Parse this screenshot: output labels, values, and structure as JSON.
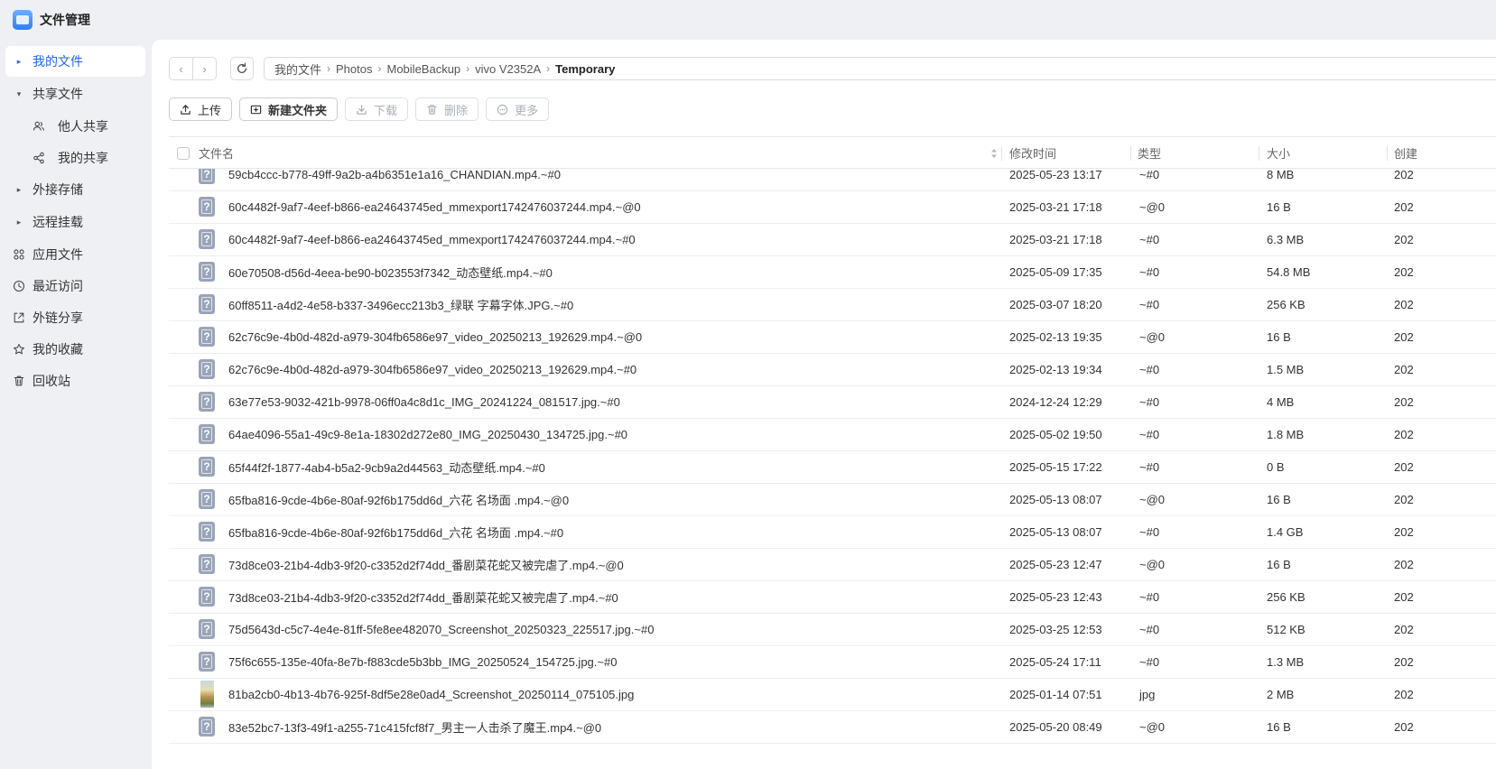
{
  "app": {
    "title": "文件管理"
  },
  "sidebar": {
    "items": [
      {
        "label": "我的文件",
        "caret": "▸",
        "active": true
      },
      {
        "label": "共享文件",
        "caret": "▾"
      },
      {
        "label": "他人共享",
        "icon": "users-icon",
        "sub": true
      },
      {
        "label": "我的共享",
        "icon": "share-icon",
        "sub": true
      },
      {
        "label": "外接存储",
        "caret": "▸"
      },
      {
        "label": "远程挂载",
        "caret": "▸"
      },
      {
        "label": "应用文件",
        "icon": "apps-icon"
      },
      {
        "label": "最近访问",
        "icon": "clock-icon"
      },
      {
        "label": "外链分享",
        "icon": "external-link-icon"
      },
      {
        "label": "我的收藏",
        "icon": "star-icon"
      },
      {
        "label": "回收站",
        "icon": "trash-icon"
      }
    ]
  },
  "nav": {
    "back": "‹",
    "forward": "›"
  },
  "breadcrumb": [
    "我的文件",
    "Photos",
    "MobileBackup",
    "vivo V2352A",
    "Temporary"
  ],
  "toolbar": {
    "upload": "上传",
    "new_folder": "新建文件夹",
    "download": "下载",
    "delete": "删除",
    "more": "更多"
  },
  "table": {
    "columns": {
      "name": "文件名",
      "modified": "修改时间",
      "type": "类型",
      "size": "大小",
      "created": "创建"
    },
    "rows": [
      {
        "name": "59cb4ccc-b778-49ff-9a2b-a4b6351e1a16_CHANDIAN.mp4.~#0",
        "modified": "2025-05-23 13:17",
        "type": "~#0",
        "size": "8 MB",
        "created": "202",
        "icon": "unknown-file-icon"
      },
      {
        "name": "60c4482f-9af7-4eef-b866-ea24643745ed_mmexport1742476037244.mp4.~@0",
        "modified": "2025-03-21 17:18",
        "type": "~@0",
        "size": "16 B",
        "created": "202",
        "icon": "unknown-file-icon"
      },
      {
        "name": "60c4482f-9af7-4eef-b866-ea24643745ed_mmexport1742476037244.mp4.~#0",
        "modified": "2025-03-21 17:18",
        "type": "~#0",
        "size": "6.3 MB",
        "created": "202",
        "icon": "unknown-file-icon"
      },
      {
        "name": "60e70508-d56d-4eea-be90-b023553f7342_动态壁纸.mp4.~#0",
        "modified": "2025-05-09 17:35",
        "type": "~#0",
        "size": "54.8 MB",
        "created": "202",
        "icon": "unknown-file-icon"
      },
      {
        "name": "60ff8511-a4d2-4e58-b337-3496ecc213b3_绿联 字幕字体.JPG.~#0",
        "modified": "2025-03-07 18:20",
        "type": "~#0",
        "size": "256 KB",
        "created": "202",
        "icon": "unknown-file-icon"
      },
      {
        "name": "62c76c9e-4b0d-482d-a979-304fb6586e97_video_20250213_192629.mp4.~@0",
        "modified": "2025-02-13 19:35",
        "type": "~@0",
        "size": "16 B",
        "created": "202",
        "icon": "unknown-file-icon"
      },
      {
        "name": "62c76c9e-4b0d-482d-a979-304fb6586e97_video_20250213_192629.mp4.~#0",
        "modified": "2025-02-13 19:34",
        "type": "~#0",
        "size": "1.5 MB",
        "created": "202",
        "icon": "unknown-file-icon"
      },
      {
        "name": "63e77e53-9032-421b-9978-06ff0a4c8d1c_IMG_20241224_081517.jpg.~#0",
        "modified": "2024-12-24 12:29",
        "type": "~#0",
        "size": "4 MB",
        "created": "202",
        "icon": "unknown-file-icon"
      },
      {
        "name": "64ae4096-55a1-49c9-8e1a-18302d272e80_IMG_20250430_134725.jpg.~#0",
        "modified": "2025-05-02 19:50",
        "type": "~#0",
        "size": "1.8 MB",
        "created": "202",
        "icon": "unknown-file-icon"
      },
      {
        "name": "65f44f2f-1877-4ab4-b5a2-9cb9a2d44563_动态壁纸.mp4.~#0",
        "modified": "2025-05-15 17:22",
        "type": "~#0",
        "size": "0 B",
        "created": "202",
        "icon": "unknown-file-icon"
      },
      {
        "name": "65fba816-9cde-4b6e-80af-92f6b175dd6d_六花 名场面 .mp4.~@0",
        "modified": "2025-05-13 08:07",
        "type": "~@0",
        "size": "16 B",
        "created": "202",
        "icon": "unknown-file-icon"
      },
      {
        "name": "65fba816-9cde-4b6e-80af-92f6b175dd6d_六花 名场面 .mp4.~#0",
        "modified": "2025-05-13 08:07",
        "type": "~#0",
        "size": "1.4 GB",
        "created": "202",
        "icon": "unknown-file-icon"
      },
      {
        "name": "73d8ce03-21b4-4db3-9f20-c3352d2f74dd_番剧菜花蛇又被完虐了.mp4.~@0",
        "modified": "2025-05-23 12:47",
        "type": "~@0",
        "size": "16 B",
        "created": "202",
        "icon": "unknown-file-icon"
      },
      {
        "name": "73d8ce03-21b4-4db3-9f20-c3352d2f74dd_番剧菜花蛇又被完虐了.mp4.~#0",
        "modified": "2025-05-23 12:43",
        "type": "~#0",
        "size": "256 KB",
        "created": "202",
        "icon": "unknown-file-icon"
      },
      {
        "name": "75d5643d-c5c7-4e4e-81ff-5fe8ee482070_Screenshot_20250323_225517.jpg.~#0",
        "modified": "2025-03-25 12:53",
        "type": "~#0",
        "size": "512 KB",
        "created": "202",
        "icon": "unknown-file-icon"
      },
      {
        "name": "75f6c655-135e-40fa-8e7b-f883cde5b3bb_IMG_20250524_154725.jpg.~#0",
        "modified": "2025-05-24 17:11",
        "type": "~#0",
        "size": "1.3 MB",
        "created": "202",
        "icon": "unknown-file-icon"
      },
      {
        "name": "81ba2cb0-4b13-4b76-925f-8df5e28e0ad4_Screenshot_20250114_075105.jpg",
        "modified": "2025-01-14 07:51",
        "type": "jpg",
        "size": "2 MB",
        "created": "202",
        "icon": "image-thumbnail"
      },
      {
        "name": "83e52bc7-13f3-49f1-a255-71c415fcf8f7_男主一人击杀了魔王.mp4.~@0",
        "modified": "2025-05-20 08:49",
        "type": "~@0",
        "size": "16 B",
        "created": "202",
        "icon": "unknown-file-icon"
      }
    ]
  }
}
